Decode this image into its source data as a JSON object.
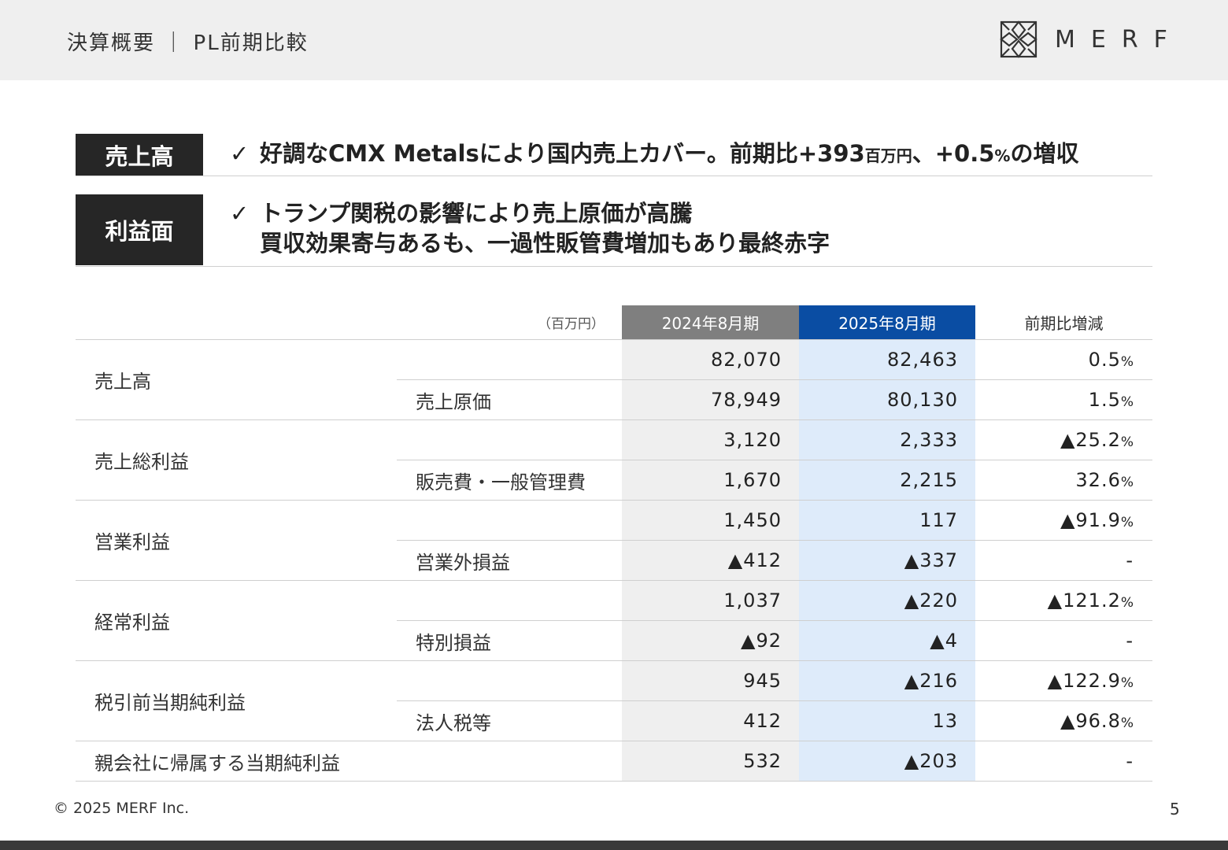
{
  "header": {
    "title": "決算概要 ｜ PL前期比較",
    "logo_text": "MERF"
  },
  "summary": [
    {
      "label": "売上高",
      "check": "✓",
      "line1_main": "好調なCMX Metalsにより国内売上カバー。前期比+393",
      "line1_unit": "百万円",
      "line1_mid": "、+0.5",
      "line1_pct": "%",
      "line1_end": "の増収"
    },
    {
      "label": "利益面",
      "check": "✓",
      "line1": "トランプ関税の影響により売上原価が高騰",
      "line2": "買収効果寄与あるも、一過性販管費増加もあり最終赤字"
    }
  ],
  "table": {
    "unit": "（百万円）",
    "col_2024": "2024年8月期",
    "col_2025": "2025年8月期",
    "col_diff": "前期比増減",
    "rows": [
      {
        "group": "売上高",
        "item": "",
        "v2024": "82,070",
        "v2025": "82,463",
        "diff": "0.5",
        "pct": "%"
      },
      {
        "group": "",
        "item": "売上原価",
        "v2024": "78,949",
        "v2025": "80,130",
        "diff": "1.5",
        "pct": "%"
      },
      {
        "group": "売上総利益",
        "item": "",
        "v2024": "3,120",
        "v2025": "2,333",
        "diff": "▲25.2",
        "pct": "%"
      },
      {
        "group": "",
        "item": "販売費・一般管理費",
        "v2024": "1,670",
        "v2025": "2,215",
        "diff": "32.6",
        "pct": "%"
      },
      {
        "group": "営業利益",
        "item": "",
        "v2024": "1,450",
        "v2025": "117",
        "diff": "▲91.9",
        "pct": "%"
      },
      {
        "group": "",
        "item": "営業外損益",
        "v2024": "▲412",
        "v2025": "▲337",
        "diff": "-",
        "pct": ""
      },
      {
        "group": "経常利益",
        "item": "",
        "v2024": "1,037",
        "v2025": "▲220",
        "diff": "▲121.2",
        "pct": "%"
      },
      {
        "group": "",
        "item": "特別損益",
        "v2024": "▲92",
        "v2025": "▲4",
        "diff": "-",
        "pct": ""
      },
      {
        "group": "税引前当期純利益",
        "item": "",
        "v2024": "945",
        "v2025": "▲216",
        "diff": "▲122.9",
        "pct": "%"
      },
      {
        "group": "",
        "item": "法人税等",
        "v2024": "412",
        "v2025": "13",
        "diff": "▲96.8",
        "pct": "%"
      },
      {
        "group": "親会社に帰属する当期純利益",
        "item": "",
        "v2024": "532",
        "v2025": "▲203",
        "diff": "-",
        "pct": ""
      }
    ]
  },
  "footer": {
    "copyright": "© 2025 MERF Inc.",
    "page": "5"
  },
  "colors": {
    "header_bg": "#efefef",
    "label_bg": "#262626",
    "col_2024_header": "#7f7f7f",
    "col_2025_header": "#0a4da3",
    "col_2024_cell": "#efefef",
    "col_2025_cell": "#deebfa"
  }
}
